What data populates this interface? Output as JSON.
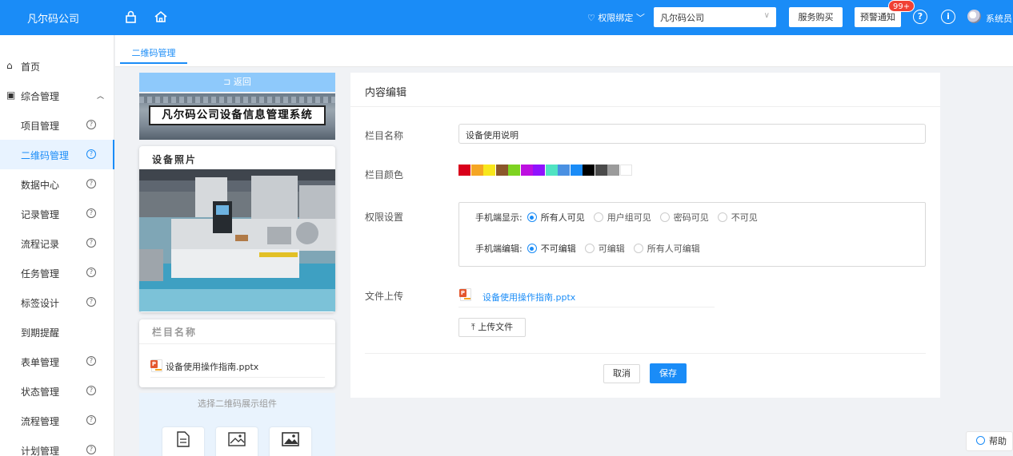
{
  "topbar": {
    "brand": "凡尔码公司",
    "perm_bind": "权限绑定",
    "company_select": "凡尔码公司",
    "service_buy": "服务购买",
    "alert_notice": "预警通知",
    "alert_badge": "99+",
    "help_symbol": "?",
    "info_symbol": "i",
    "username": "系统员",
    "accent": "#1a8cf7"
  },
  "sidebar": {
    "home": "首页",
    "group": "综合管理",
    "items": [
      {
        "label": "项目管理"
      },
      {
        "label": "二维码管理"
      },
      {
        "label": "数据中心"
      },
      {
        "label": "记录管理"
      },
      {
        "label": "流程记录"
      },
      {
        "label": "任务管理"
      },
      {
        "label": "标签设计"
      },
      {
        "label": "到期提醒"
      },
      {
        "label": "表单管理"
      },
      {
        "label": "状态管理"
      },
      {
        "label": "流程管理"
      },
      {
        "label": "计划管理"
      }
    ],
    "active_item": "二维码管理"
  },
  "tabs": {
    "active": "二维码管理"
  },
  "preview": {
    "back": "返回",
    "banner_title": "凡尔码公司设备信息管理系统",
    "photo_card_title": "设备照片",
    "section_title": "栏目名称",
    "file_name": "设备使用操作指南.pptx",
    "component_header": "选择二维码展示组件",
    "component_icons": [
      "document-icon",
      "image-icon",
      "gallery-icon"
    ]
  },
  "editor": {
    "title": "内容编辑",
    "name_label": "栏目名称",
    "name_value": "设备使用说明",
    "color_label": "栏目颜色",
    "colors": [
      "#d9001b",
      "#f5a623",
      "#f8e71c",
      "#8b572a",
      "#7ed321",
      "#bd10e0",
      "#9013fe",
      "#50e3c2",
      "#4a90e2",
      "#1a8cf7",
      "#000000",
      "#4a4a4a",
      "#9b9b9b",
      "#ffffff"
    ],
    "perm_label": "权限设置",
    "mobile_display_label": "手机端显示:",
    "display_options": [
      "所有人可见",
      "用户组可见",
      "密码可见",
      "不可见"
    ],
    "display_selected": 0,
    "mobile_edit_label": "手机端编辑:",
    "edit_options": [
      "不可编辑",
      "可编辑",
      "所有人可编辑"
    ],
    "edit_selected": 0,
    "upload_label": "文件上传",
    "uploaded_file": "设备使用操作指南.pptx",
    "upload_button": "上传文件",
    "cancel": "取消",
    "save": "保存"
  },
  "help_button": "帮助"
}
